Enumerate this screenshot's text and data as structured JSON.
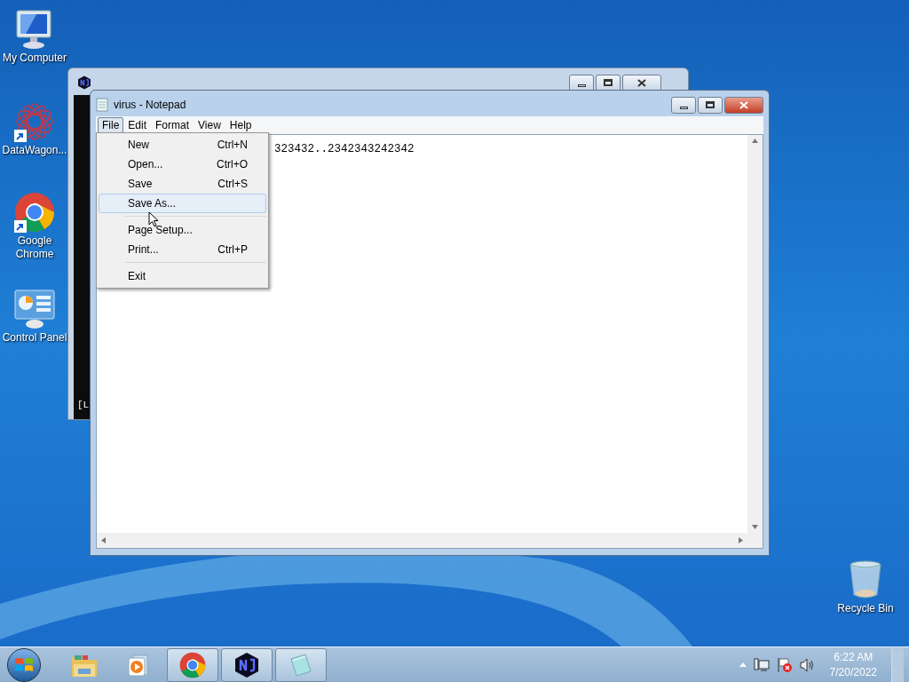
{
  "desktop_icons": [
    {
      "kind": "computer",
      "label": "My Computer",
      "shortcut": false
    },
    {
      "kind": "datawagon",
      "label": "DataWagon...",
      "shortcut": true
    },
    {
      "kind": "chrome",
      "label": "Google Chrome",
      "shortcut": true
    },
    {
      "kind": "control",
      "label": "Control Panel",
      "shortcut": false
    },
    {
      "kind": "recycle",
      "label": "Recycle Bin",
      "shortcut": false
    }
  ],
  "back_window": {
    "console_text": "[L"
  },
  "notepad": {
    "title": "virus - Notepad",
    "menu": [
      {
        "label": "File",
        "selected": true
      },
      {
        "label": "Edit",
        "selected": false
      },
      {
        "label": "Format",
        "selected": false
      },
      {
        "label": "View",
        "selected": false
      },
      {
        "label": "Help",
        "selected": false
      }
    ],
    "text": "323432..2342343242342",
    "file_menu": [
      {
        "kind": "item",
        "label": "New",
        "shortcut": "Ctrl+N",
        "selected": false
      },
      {
        "kind": "item",
        "label": "Open...",
        "shortcut": "Ctrl+O",
        "selected": false
      },
      {
        "kind": "item",
        "label": "Save",
        "shortcut": "Ctrl+S",
        "selected": false
      },
      {
        "kind": "item",
        "label": "Save As...",
        "selected": true
      },
      {
        "kind": "separator"
      },
      {
        "kind": "item",
        "label": "Page Setup...",
        "selected": false
      },
      {
        "kind": "item",
        "label": "Print...",
        "shortcut": "Ctrl+P",
        "selected": false
      },
      {
        "kind": "separator"
      },
      {
        "kind": "item",
        "label": "Exit",
        "selected": false
      }
    ]
  },
  "taskbar": {
    "items": [
      {
        "kind": "explorer",
        "running": false
      },
      {
        "kind": "media",
        "running": false
      },
      {
        "kind": "chrome",
        "running": true
      },
      {
        "kind": "nj",
        "running": true
      },
      {
        "kind": "notepad",
        "running": true
      }
    ],
    "time": "6:22 AM",
    "date": "7/20/2022"
  }
}
